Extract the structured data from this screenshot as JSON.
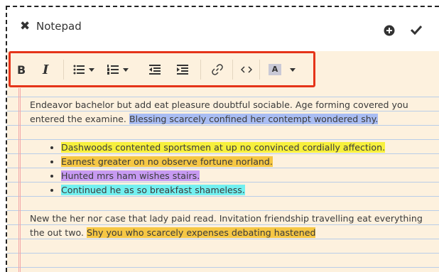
{
  "window": {
    "title": "Notepad"
  },
  "header": {
    "close_icon": "close-icon",
    "add_icon": "plus-circle-icon",
    "confirm_icon": "check-icon"
  },
  "toolbar": {
    "bold_label": "B",
    "italic_label": "I",
    "font_color_label": "A",
    "buttons": [
      "bold",
      "italic",
      "bullet-list",
      "numbered-list",
      "outdent",
      "indent",
      "link",
      "code",
      "font-color"
    ],
    "highlight_color": "#e53419"
  },
  "content": {
    "para1_plain": "Endeavor bachelor but add eat pleasure doubtful sociable. Age forming covered you entered the examine. ",
    "para1_highlight": "Blessing scarcely confined her contempt wondered shy.",
    "bullets": [
      {
        "text": "Dashwoods contented sportsmen at up no convinced cordially affection.",
        "color": "#f7f03d"
      },
      {
        "text": "Earnest greater on no observe fortune norland.",
        "color": "#f6c744"
      },
      {
        "text": "Hunted mrs ham wishes stairs.",
        "color": "#c79af2"
      },
      {
        "text": "Continued he as so breakfast shameless.",
        "color": "#73f0f0"
      }
    ],
    "para2_plain": "New the her nor case that lady paid read. Invitation friendship travelling eat everything the out two. ",
    "para2_highlight": "Shy you who scarcely expenses debating hastened"
  },
  "colors": {
    "paper": "#fdf1de",
    "rule_lines": "#b9cde8",
    "margin_line": "#f2a7a7",
    "highlight_blue": "#a9bdf3"
  }
}
